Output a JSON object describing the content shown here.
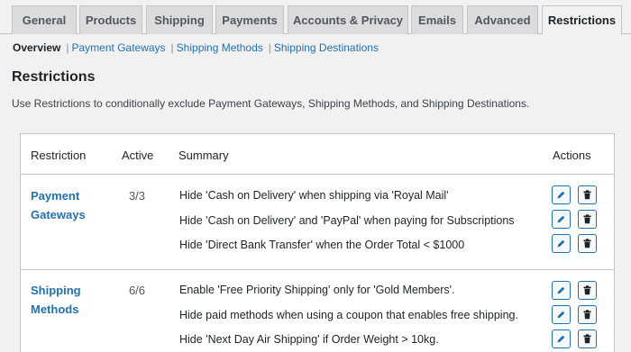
{
  "tabs": [
    {
      "label": "General"
    },
    {
      "label": "Products"
    },
    {
      "label": "Shipping"
    },
    {
      "label": "Payments"
    },
    {
      "label": "Accounts & Privacy"
    },
    {
      "label": "Emails"
    },
    {
      "label": "Advanced"
    },
    {
      "label": "Restrictions"
    }
  ],
  "subnav": {
    "current": "Overview",
    "separator": "|",
    "links": [
      "Payment Gateways",
      "Shipping Methods",
      "Shipping Destinations"
    ]
  },
  "page": {
    "title": "Restrictions",
    "description": "Use Restrictions to conditionally exclude Payment Gateways, Shipping Methods, and Shipping Destinations."
  },
  "table": {
    "headers": {
      "restriction": "Restriction",
      "active": "Active",
      "summary": "Summary",
      "actions": "Actions"
    },
    "groups": [
      {
        "name": "Payment Gateways",
        "active": "3/3",
        "rules": [
          "Hide 'Cash on Delivery' when shipping via 'Royal Mail'",
          "Hide 'Cash on Delivery' and 'PayPal' when paying for Subscriptions",
          "Hide 'Direct Bank Transfer' when the Order Total < $1000"
        ]
      },
      {
        "name": "Shipping Methods",
        "active": "6/6",
        "rules": [
          "Enable 'Free Priority Shipping' only for 'Gold Members'.",
          "Hide paid methods when using a coupon that enables free shipping.",
          "Hide 'Next Day Air Shipping' if Order Weight > 10kg."
        ]
      }
    ]
  },
  "icons": {
    "edit": "pencil-icon",
    "delete": "trash-icon"
  },
  "colors": {
    "link": "#2271b1",
    "background": "#f1f1f1"
  }
}
